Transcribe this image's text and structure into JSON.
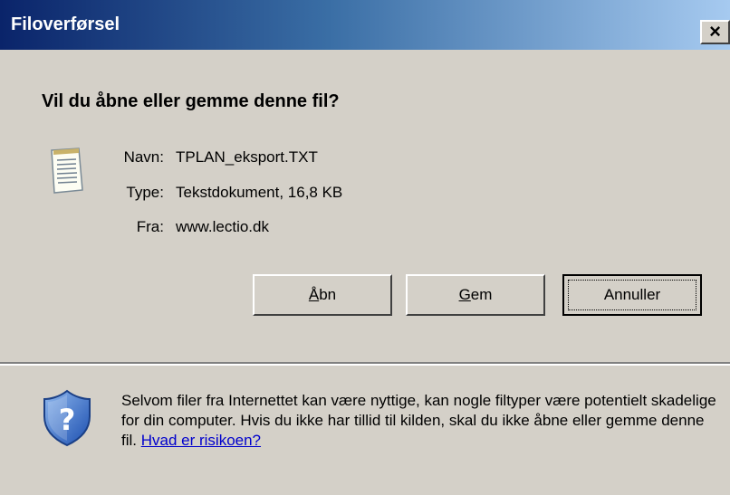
{
  "dialog": {
    "title": "Filoverførsel",
    "close_glyph": "×",
    "question": "Vil du åbne eller gemme denne fil?"
  },
  "file": {
    "name_label": "Navn:",
    "name_value": "TPLAN_eksport.TXT",
    "type_label": "Type:",
    "type_value": "Tekstdokument, 16,8 KB",
    "from_label": "Fra:",
    "from_value": "www.lectio.dk"
  },
  "buttons": {
    "open_mnemonic": "Å",
    "open_rest": "bn",
    "save_mnemonic": "G",
    "save_rest": "em",
    "cancel": "Annuller"
  },
  "warning": {
    "text": "Selvom filer fra Internettet kan være nyttige, kan nogle filtyper være potentielt skadelige for din computer. Hvis du ikke har tillid til kilden, skal du ikke åbne eller gemme denne fil. ",
    "link": "Hvad er risikoen?"
  },
  "icons": {
    "document": "text-document-icon",
    "shield": "security-shield-question-icon"
  },
  "colors": {
    "titlebar_start": "#0a246a",
    "titlebar_end": "#a6caf0",
    "window_bg": "#d4d0c8",
    "link": "#0000cc"
  }
}
